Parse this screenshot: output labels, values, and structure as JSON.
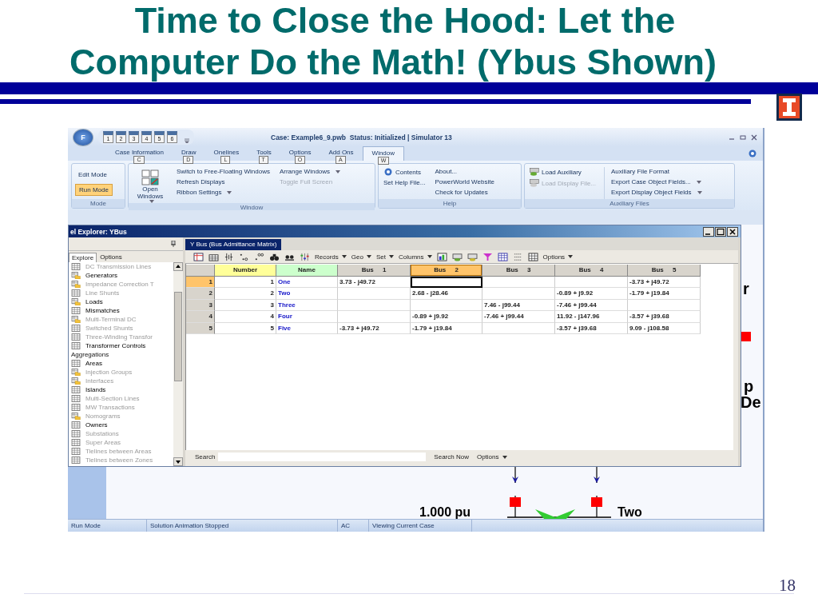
{
  "slide": {
    "title_lines": [
      "Time to Close the Hood: Let the",
      "Computer Do the Math! (Ybus Shown)"
    ],
    "page_number": "18"
  },
  "app": {
    "app_button": "F",
    "quick_access": [
      "1",
      "2",
      "3",
      "4",
      "5",
      "6"
    ],
    "title": "Case: Example6_9.pwb  Status: Initialized | Simulator 13",
    "tabs": [
      {
        "label": "Case Information",
        "keytip": "C",
        "selected": false
      },
      {
        "label": "Draw",
        "keytip": "D",
        "selected": false
      },
      {
        "label": "Onelines",
        "keytip": "L",
        "selected": false
      },
      {
        "label": "Tools",
        "keytip": "T",
        "selected": false
      },
      {
        "label": "Options",
        "keytip": "O",
        "selected": false
      },
      {
        "label": "Add Ons",
        "keytip": "A",
        "selected": false
      },
      {
        "label": "Window",
        "keytip": "W",
        "selected": true
      }
    ],
    "mode_group": {
      "label": "Mode",
      "items": [
        {
          "label": "Edit Mode",
          "selected": false
        },
        {
          "label": "Run Mode",
          "selected": true
        }
      ]
    },
    "window_group": {
      "label": "Window",
      "big_button": "Open Windows",
      "column_1": [
        {
          "label": "Switch to Free-Floating Windows",
          "dropdown": false,
          "disabled": false
        },
        {
          "label": "Refresh Displays",
          "dropdown": false,
          "disabled": false
        },
        {
          "label": "Ribbon Settings",
          "dropdown": true,
          "disabled": false
        }
      ],
      "column_2": [
        {
          "label": "Arrange Windows",
          "dropdown": true,
          "disabled": false
        },
        {
          "label": "Toggle Full Screen",
          "dropdown": false,
          "disabled": true
        }
      ]
    },
    "help_group": {
      "label": "Help",
      "column_1": [
        {
          "label": "Contents",
          "icon": true
        },
        {
          "label": "Set Help File...",
          "icon": false
        }
      ],
      "column_2": [
        {
          "label": "About...",
          "icon": false
        },
        {
          "label": "PowerWorld Website",
          "icon": false
        },
        {
          "label": "Check for Updates",
          "icon": false
        }
      ]
    },
    "aux_group": {
      "label": "Auxiliary Files",
      "column_1": [
        {
          "label": "Load Auxiliary",
          "disabled": false
        },
        {
          "label": "Load Display File...",
          "disabled": true
        }
      ],
      "column_2": [
        {
          "label": "Auxiliary File Format",
          "dropdown": false,
          "disabled": false
        },
        {
          "label": "Export Case Object Fields...",
          "dropdown": true,
          "disabled": false
        },
        {
          "label": "Export Display Object Fields",
          "dropdown": true,
          "disabled": false
        }
      ]
    },
    "status_bar": [
      "Run Mode",
      "Solution Animation Stopped",
      "AC",
      "Viewing Current Case"
    ]
  },
  "explorer": {
    "title": "el Explorer: YBus",
    "tabs": [
      {
        "label": "Explore",
        "selected": true
      },
      {
        "label": "Options",
        "selected": false
      }
    ],
    "items": [
      {
        "label": "DC Transmission Lines",
        "kind": "table",
        "disabled": true
      },
      {
        "label": "Generators",
        "kind": "folder",
        "disabled": false
      },
      {
        "label": "Impedance Correction T",
        "kind": "folder",
        "disabled": true
      },
      {
        "label": "Line Shunts",
        "kind": "table",
        "disabled": true
      },
      {
        "label": "Loads",
        "kind": "folder",
        "disabled": false
      },
      {
        "label": "Mismatches",
        "kind": "table",
        "disabled": false
      },
      {
        "label": "Multi-Terminal DC",
        "kind": "folder",
        "disabled": true
      },
      {
        "label": "Switched Shunts",
        "kind": "table",
        "disabled": true
      },
      {
        "label": "Three-Winding Transfor",
        "kind": "table",
        "disabled": true
      },
      {
        "label": "Transformer Controls",
        "kind": "table",
        "disabled": false
      },
      {
        "label": "Aggregations",
        "kind": "heading"
      },
      {
        "label": "Areas",
        "kind": "table",
        "disabled": false
      },
      {
        "label": "Injection Groups",
        "kind": "folder",
        "disabled": true
      },
      {
        "label": "Interfaces",
        "kind": "folder",
        "disabled": true
      },
      {
        "label": "Islands",
        "kind": "table",
        "disabled": false
      },
      {
        "label": "Multi-Section Lines",
        "kind": "table",
        "disabled": true
      },
      {
        "label": "MW Transactions",
        "kind": "table",
        "disabled": true
      },
      {
        "label": "Nomograms",
        "kind": "folder",
        "disabled": true
      },
      {
        "label": "Owners",
        "kind": "table",
        "disabled": false
      },
      {
        "label": "Substations",
        "kind": "table",
        "disabled": true
      },
      {
        "label": "Super Areas",
        "kind": "table",
        "disabled": true
      },
      {
        "label": "Tielines between Areas",
        "kind": "table",
        "disabled": true
      },
      {
        "label": "Tielines between Zones",
        "kind": "table",
        "disabled": true
      }
    ]
  },
  "grid": {
    "tab": "Y Bus (Bus Admittance Matrix)",
    "toolbar_menus": [
      "Records",
      "Geo",
      "Set",
      "Columns"
    ],
    "options_menu": "Options",
    "columns": [
      {
        "label": "Number",
        "color": "#ffff99",
        "selected": false
      },
      {
        "label": "Name",
        "color": "#ccffcc",
        "selected": false
      },
      {
        "label": "Bus     1",
        "color": "#d8d4cc",
        "selected": false
      },
      {
        "label": "Bus     2",
        "color": "#ffc46a",
        "selected": true
      },
      {
        "label": "Bus     3",
        "color": "#d8d4cc",
        "selected": false
      },
      {
        "label": "Bus     4",
        "color": "#d8d4cc",
        "selected": false
      },
      {
        "label": "Bus     5",
        "color": "#d8d4cc",
        "selected": false
      }
    ],
    "rows": [
      {
        "header": "1",
        "selected": true,
        "cells": [
          "1",
          "One",
          "3.73 - j49.72",
          "",
          "",
          "",
          "-3.73 + j49.72"
        ]
      },
      {
        "header": "2",
        "selected": false,
        "cells": [
          "2",
          "Two",
          "",
          "2.68 - j28.46",
          "",
          "-0.89 + j9.92",
          "-1.79 + j19.84"
        ]
      },
      {
        "header": "3",
        "selected": false,
        "cells": [
          "3",
          "Three",
          "",
          "",
          "7.46 - j99.44",
          "-7.46 + j99.44",
          ""
        ]
      },
      {
        "header": "4",
        "selected": false,
        "cells": [
          "4",
          "Four",
          "",
          "-0.89 + j9.92",
          "-7.46 + j99.44",
          "11.92 - j147.96",
          "-3.57 + j39.68"
        ]
      },
      {
        "header": "5",
        "selected": false,
        "cells": [
          "5",
          "Five",
          "-3.73 + j49.72",
          "-1.79 + j19.84",
          "",
          "-3.57 + j39.68",
          "9.09 - j108.58"
        ]
      }
    ],
    "search": {
      "label": "Search",
      "button": "Search Now",
      "options": "Options"
    }
  },
  "oneline": {
    "labels": [
      "r",
      "p",
      "De"
    ],
    "bus_voltage": "1.000 pu",
    "bus_name": "Two"
  }
}
